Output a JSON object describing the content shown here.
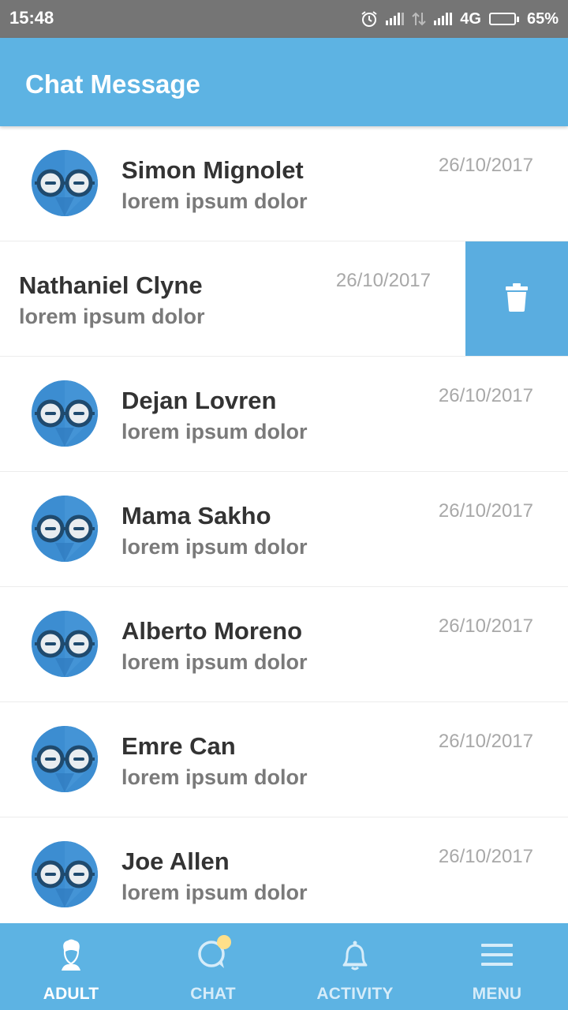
{
  "status_bar": {
    "time": "15:48",
    "network": "4G",
    "battery_percent": "65%",
    "battery_level": 0.65,
    "icons": [
      "alarm-icon",
      "signal-icon",
      "data-transfer-icon",
      "signal-icon",
      "battery-icon"
    ]
  },
  "app_bar": {
    "title": "Chat Message"
  },
  "chats": [
    {
      "name": "Simon Mignolet",
      "preview": "lorem ipsum dolor",
      "date": "26/10/2017",
      "avatar_icon": "glasses-avatar-icon"
    },
    {
      "name": "Nathaniel Clyne",
      "preview": "lorem ipsum dolor",
      "date": "26/10/2017",
      "swiped": true,
      "action_icon": "trash-icon"
    },
    {
      "name": "Dejan Lovren",
      "preview": "lorem ipsum dolor",
      "date": "26/10/2017",
      "avatar_icon": "glasses-avatar-icon"
    },
    {
      "name": "Mama Sakho",
      "preview": "lorem ipsum dolor",
      "date": "26/10/2017",
      "avatar_icon": "glasses-avatar-icon"
    },
    {
      "name": "Alberto Moreno",
      "preview": "lorem ipsum dolor",
      "date": "26/10/2017",
      "avatar_icon": "glasses-avatar-icon"
    },
    {
      "name": "Emre Can",
      "preview": "lorem ipsum dolor",
      "date": "26/10/2017",
      "avatar_icon": "glasses-avatar-icon"
    },
    {
      "name": "Joe Allen",
      "preview": "lorem ipsum dolor",
      "date": "26/10/2017",
      "avatar_icon": "glasses-avatar-icon"
    }
  ],
  "bottom_nav": [
    {
      "label": "ADULT",
      "icon": "person-head-icon",
      "active": true
    },
    {
      "label": "CHAT",
      "icon": "chat-bubble-icon",
      "has_notification": true
    },
    {
      "label": "ACTIVITY",
      "icon": "bell-icon"
    },
    {
      "label": "MENU",
      "icon": "menu-icon"
    }
  ],
  "colors": {
    "status_bar": "#757575",
    "primary": "#5db3e3",
    "delete_action": "#5aade0",
    "avatar": "#3c8dd1",
    "name_text": "#333333",
    "preview_text": "#7a7a7a",
    "date_text": "#a8a8a8",
    "notification_dot": "#ffe08a"
  }
}
